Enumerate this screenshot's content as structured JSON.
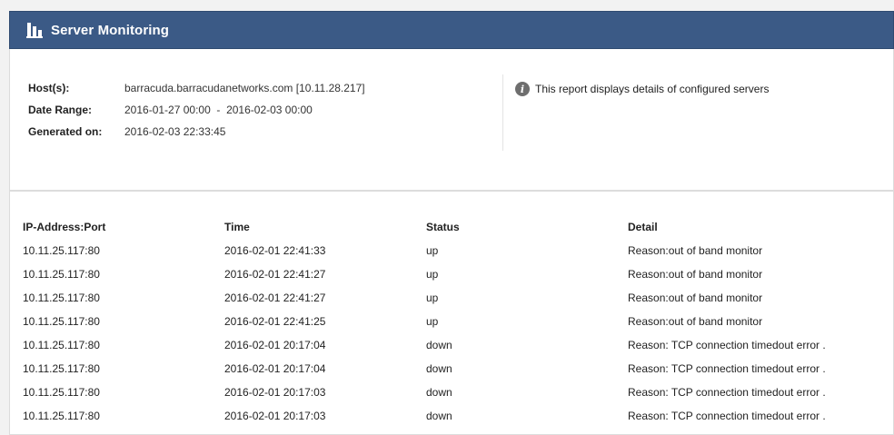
{
  "header": {
    "title": "Server Monitoring",
    "icon": "chart-bars-icon",
    "bg_color": "#3b5a86"
  },
  "summary": {
    "host_label": "Host(s):",
    "host_value": "barracuda.barracudanetworks.com [10.11.28.217]",
    "date_label": "Date Range:",
    "date_value": "2016-01-27 00:00  -  2016-02-03 00:00",
    "generated_label": "Generated on:",
    "generated_value": "2016-02-03 22:33:45",
    "note": "This report displays details of configured servers",
    "note_icon": "info-icon"
  },
  "table": {
    "columns": [
      "IP-Address:Port",
      "Time",
      "Status",
      "Detail"
    ],
    "rows": [
      [
        "10.11.25.117:80",
        "2016-02-01 22:41:33",
        "up",
        "Reason:out of band monitor"
      ],
      [
        "10.11.25.117:80",
        "2016-02-01 22:41:27",
        "up",
        "Reason:out of band monitor"
      ],
      [
        "10.11.25.117:80",
        "2016-02-01 22:41:27",
        "up",
        "Reason:out of band monitor"
      ],
      [
        "10.11.25.117:80",
        "2016-02-01 22:41:25",
        "up",
        "Reason:out of band monitor"
      ],
      [
        "10.11.25.117:80",
        "2016-02-01 20:17:04",
        "down",
        "Reason: TCP connection timedout error ."
      ],
      [
        "10.11.25.117:80",
        "2016-02-01 20:17:04",
        "down",
        "Reason: TCP connection timedout error ."
      ],
      [
        "10.11.25.117:80",
        "2016-02-01 20:17:03",
        "down",
        "Reason: TCP connection timedout error ."
      ],
      [
        "10.11.25.117:80",
        "2016-02-01 20:17:03",
        "down",
        "Reason: TCP connection timedout error ."
      ]
    ]
  }
}
